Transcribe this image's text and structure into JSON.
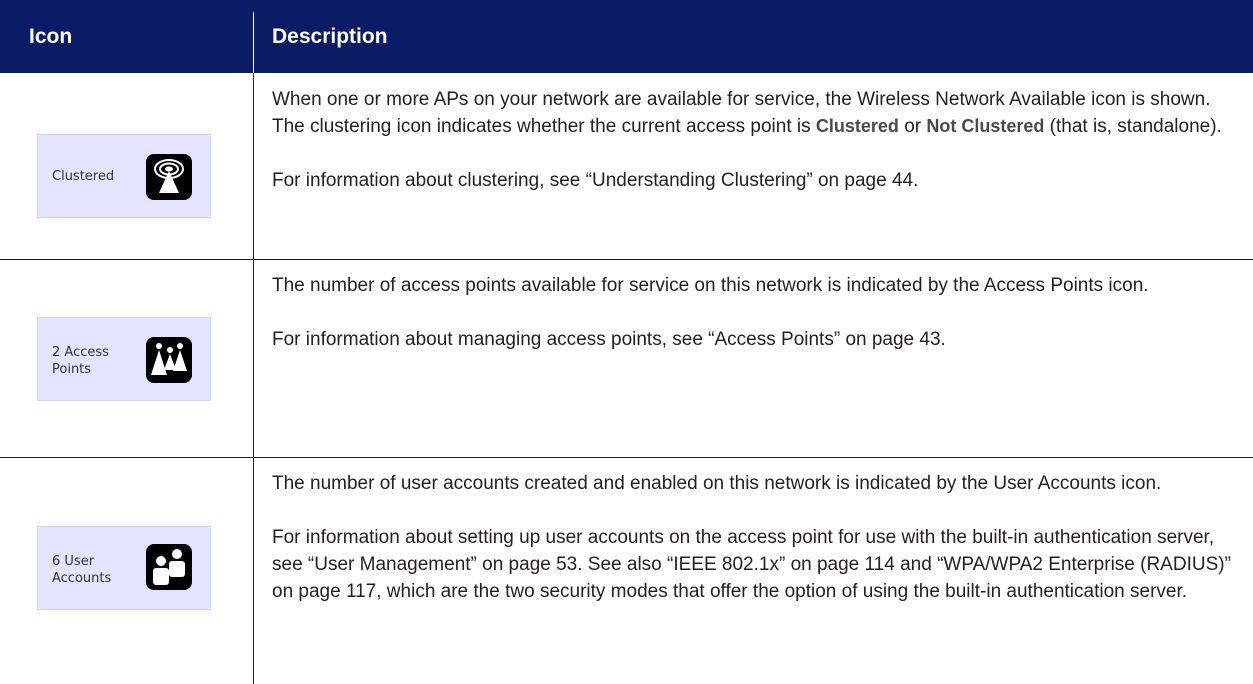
{
  "header": {
    "icon": "Icon",
    "description": "Description"
  },
  "rows": [
    {
      "icon_label": "Clustered",
      "icon": "wireless-signal-icon",
      "p1_a": "When one or more APs on your network are available for service, the Wireless Network Available icon is shown. The clustering icon indicates whether the current access point is ",
      "term1": "Clustered",
      "p1_b": " or ",
      "term2": "Not Clustered",
      "p1_c": " (that is, standalone).",
      "p2": "For information about clustering, see “Understanding Clustering” on page 44."
    },
    {
      "icon_label": "2 Access Points",
      "icon": "access-points-icon",
      "p1": "The number of access points available for service on this network is indicated by the Access Points icon.",
      "p2": "For information about managing access points, see “Access Points” on page 43."
    },
    {
      "icon_label": "6 User Accounts",
      "icon": "user-accounts-icon",
      "p1": "The number of user accounts created and enabled on this network is indicated by the User Accounts icon.",
      "p2": "For information about setting up user accounts on the access point for use with the built-in authentication server, see “User Management” on page 53. See also “IEEE 802.1x” on page 114 and “WPA/WPA2 Enterprise (RADIUS)” on page 117, which are the two security modes that offer the option of using the built-in authentication server."
    }
  ],
  "colors": {
    "header_bg": "#0b1c66",
    "icon_box_bg": "#e3e4ff",
    "text": "#231f20"
  }
}
